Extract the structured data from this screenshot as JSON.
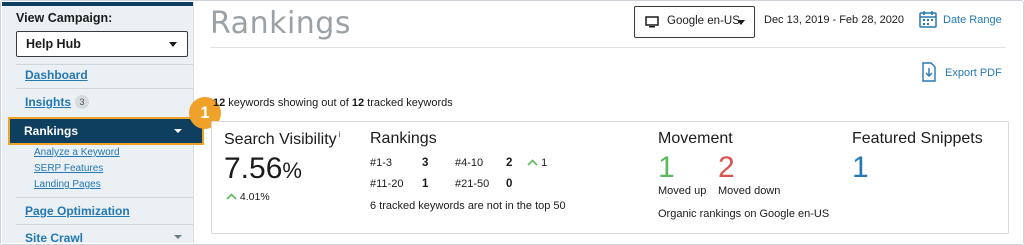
{
  "colors": {
    "sidebar_bg": "#eaf0f3",
    "active_nav_bg": "#0e3f5e",
    "highlight": "#f0a12a",
    "link": "#2478b4",
    "up": "#5cb85c",
    "down": "#d9534f",
    "title_gray": "#9aa2a8"
  },
  "sidebar": {
    "view_campaign_label": "View Campaign:",
    "campaign_value": "Help Hub",
    "nav": {
      "dashboard": "Dashboard",
      "insights": "Insights",
      "insights_badge": "3",
      "rankings": "Rankings",
      "analyze_keyword": "Analyze a Keyword",
      "serp_features": "SERP Features",
      "landing_pages": "Landing Pages",
      "page_optimization": "Page Optimization",
      "site_crawl": "Site Crawl"
    }
  },
  "step_marker": "1",
  "header": {
    "title": "Rankings",
    "engine_select": "Google en-US",
    "date_range_text": "Dec 13, 2019 - Feb 28, 2020",
    "date_range_link": "Date Range",
    "export_link": "Export PDF"
  },
  "keywords_summary": {
    "showing_count": "12",
    "middle_text": " keywords showing out of ",
    "tracked_count": "12",
    "end_text": " tracked keywords"
  },
  "search_visibility": {
    "title": "Search Visibility",
    "info_mark": "i",
    "value": "7.56",
    "unit": "%",
    "change": "4.01%"
  },
  "rankings_panel": {
    "title": "Rankings",
    "rows": [
      {
        "label": "#1-3",
        "value": "3"
      },
      {
        "label": "#4-10",
        "value": "2",
        "delta": "1"
      },
      {
        "label": "#11-20",
        "value": "1"
      },
      {
        "label": "#21-50",
        "value": "0"
      }
    ],
    "note": "6 tracked keywords are not in the top 50"
  },
  "movement": {
    "title": "Movement",
    "up_value": "1",
    "up_label": "Moved up",
    "down_value": "2",
    "down_label": "Moved down",
    "note": "Organic rankings on Google en-US"
  },
  "featured_snippets": {
    "title": "Featured Snippets",
    "value": "1"
  }
}
